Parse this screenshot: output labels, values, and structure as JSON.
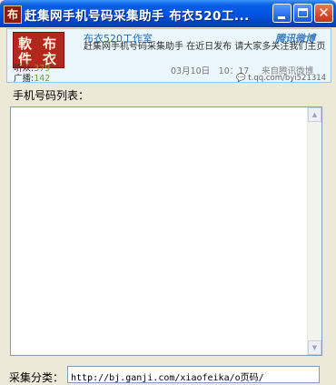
{
  "window": {
    "title": "赶集网手机号码采集助手    布衣520工...",
    "app_icon_char": "布",
    "icons": {
      "minimize": "minimize-icon",
      "maximize": "maximize-icon",
      "close": "close-icon"
    }
  },
  "weibo": {
    "stamp": [
      "軟",
      "布",
      "件",
      "衣"
    ],
    "followers_label": "听众:",
    "followers_count": "379",
    "broadcasts_label": "广播:",
    "broadcasts_count": "142",
    "user": "布衣520工作室",
    "brand": "腾讯微博",
    "message": "赶集网手机号码采集助手 在近日发布 请大家多关注我们主页",
    "time": "03月10日　10：17",
    "source": "来自腾讯微博",
    "link": "t.qq.com/byi521314"
  },
  "phone_list": {
    "label": "手机号码列表：",
    "items": []
  },
  "collect": {
    "label": "采集分类：",
    "value": "http://bj.ganji.com/xiaofeika/o页码/"
  }
}
